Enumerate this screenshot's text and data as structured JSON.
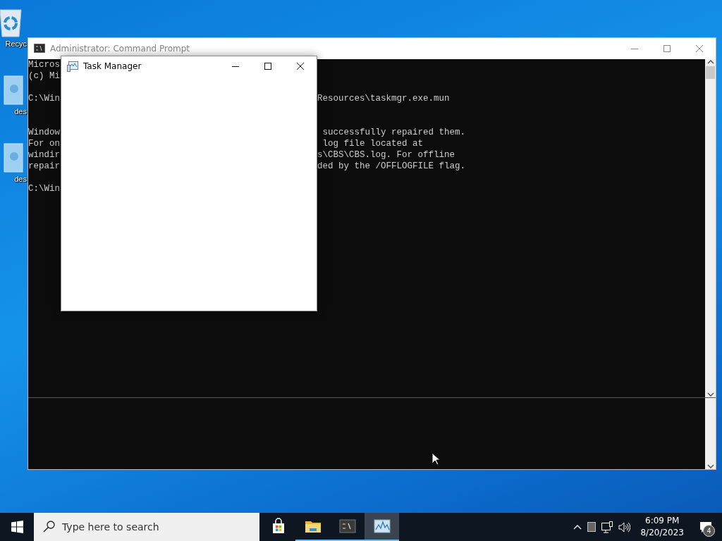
{
  "desktop_icons": [
    {
      "kind": "recycle",
      "label": "Recyc"
    },
    {
      "kind": "shortcut",
      "label": "des"
    },
    {
      "kind": "shortcut",
      "label": "des"
    }
  ],
  "cmd_window": {
    "title": "Administrator:  Command Prompt",
    "lines": [
      {
        "kind": "text",
        "left": "Micros"
      },
      {
        "kind": "text",
        "left": "(c) Mi"
      },
      {
        "kind": "blank"
      },
      {
        "kind": "text",
        "left": "C:\\Win",
        "right": "Resources\\taskmgr.exe.mun"
      },
      {
        "kind": "blank"
      },
      {
        "kind": "blank"
      },
      {
        "kind": "text",
        "left": "Window",
        "right": " successfully repaired them."
      },
      {
        "kind": "text",
        "left": "For on",
        "right": " log file located at"
      },
      {
        "kind": "text",
        "left": "windir",
        "right": "s\\CBS\\CBS.log. For offline"
      },
      {
        "kind": "text",
        "left": "repair",
        "right": "ded by the /OFFLOGFILE flag."
      },
      {
        "kind": "blank"
      },
      {
        "kind": "text",
        "left": "C:\\Win"
      }
    ]
  },
  "task_manager": {
    "title": "Task Manager"
  },
  "taskbar": {
    "search": {
      "placeholder": "Type here to search"
    },
    "apps": [
      {
        "kind": "store",
        "running": false,
        "selected": false
      },
      {
        "kind": "explorer",
        "running": true,
        "selected": false
      },
      {
        "kind": "cmd",
        "running": true,
        "selected": false
      },
      {
        "kind": "taskmgr",
        "running": true,
        "selected": true
      }
    ],
    "time": "6:09 PM",
    "date": "8/20/2023",
    "notification_count": "4"
  }
}
